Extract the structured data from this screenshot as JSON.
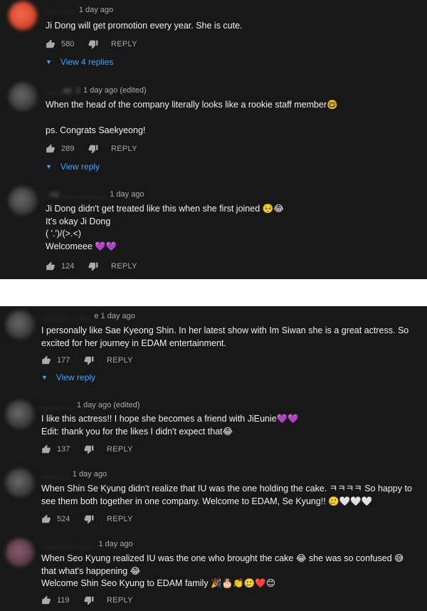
{
  "labels": {
    "reply": "REPLY"
  },
  "screenshot_1": {
    "comments": [
      {
        "time": "1 day ago",
        "lines": [
          "Ji Dong will get promotion every year. She is cute."
        ],
        "likes": "580",
        "replies_link": "View 4 replies"
      },
      {
        "time": "1 day ago (edited)",
        "lines": [
          "When the head of the company literally looks like a rookie staff member🤓",
          "",
          "ps. Congrats Saekyeong!"
        ],
        "likes": "289",
        "replies_link": "View reply"
      },
      {
        "time": "1 day ago",
        "lines": [
          "Ji Dong didn't get treated like this when she first joined 🥺😂",
          "It's okay Ji Dong",
          "( '.')/(>.<)",
          "Welcomeee 💜💜"
        ],
        "likes": "124"
      }
    ]
  },
  "screenshot_2": {
    "comments": [
      {
        "time": "e 1 day ago",
        "lines": [
          "I personally like Sae Kyeong Shin. In her latest show with Im Siwan she is a great actress. So",
          "excited for her journey in EDAM entertainment."
        ],
        "likes": "177",
        "replies_link": "View reply"
      },
      {
        "time": "1 day ago (edited)",
        "lines": [
          "I like this actress!! I hope she becomes a friend with JiEunie💜💜",
          "Edit: thank you for the likes I didn't expect that😂"
        ],
        "likes": "137"
      },
      {
        "time": "1 day ago",
        "lines": [
          "When Shin Se Kyung didn't realize that IU was the one holding the cake. ㅋㅋㅋㅋ So happy to",
          "see them both together in one company. Welcome to EDAM, Se Kyung!! 🥲🤍🤍🤍"
        ],
        "likes": "524"
      },
      {
        "time": "1 day ago",
        "lines": [
          "When Seo Kyung realized IU was the one who brought the cake 😂 she was so confused 😅",
          "that what's happening 😂",
          "Welcome Shin Seo Kyung to EDAM family 🎉🎂👏🥲❤️😊"
        ],
        "likes": "119"
      }
    ]
  }
}
